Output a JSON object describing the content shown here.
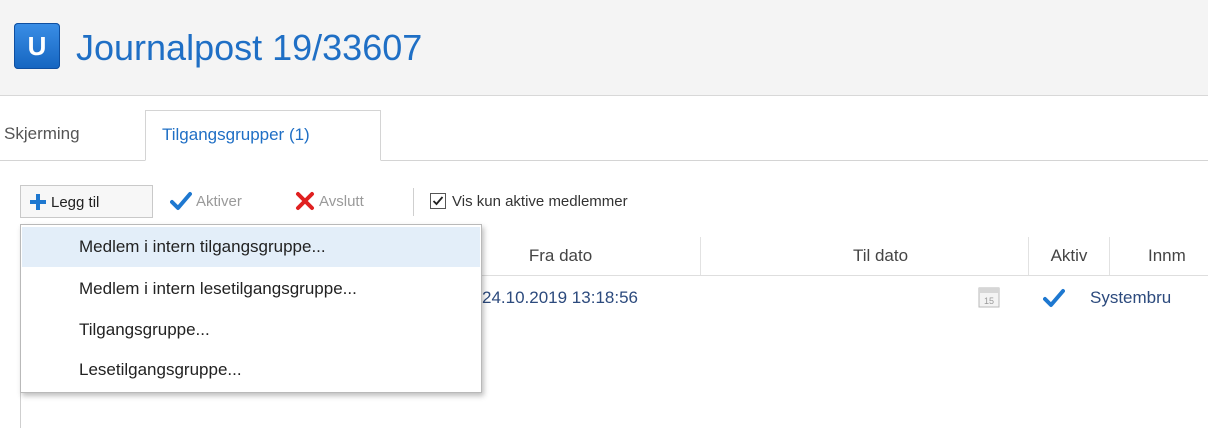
{
  "header": {
    "app_icon_letter": "U",
    "title": "Journalpost 19/33607",
    "brand_color": "#1f6fc5"
  },
  "tabs": [
    {
      "label": "Skjerming",
      "active": false
    },
    {
      "label": "Tilgangsgrupper (1)",
      "active": true
    }
  ],
  "toolbar": {
    "add_label": "Legg til",
    "activate_label": "Aktiver",
    "end_label": "Avslutt",
    "show_active_label": "Vis kun aktive medlemmer",
    "show_active_checked": true
  },
  "dropdown": {
    "items": [
      "Medlem i intern tilgangsgruppe...",
      "Medlem i intern lesetilgangsgruppe...",
      "Tilgangsgruppe...",
      "Lesetilgangsgruppe..."
    ],
    "highlighted_index": 0
  },
  "grid": {
    "columns": [
      "Fra dato",
      "Til dato",
      "Aktiv",
      "Innm"
    ],
    "rows": [
      {
        "fra_dato": "24.10.2019 13:18:56",
        "til_dato": "",
        "calendar_icon_text": "15",
        "aktiv": true,
        "user": "Systembru"
      }
    ]
  },
  "icons": {
    "add": "plus-icon",
    "activate": "checkmark-icon",
    "end": "cross-icon",
    "calendar": "calendar-icon",
    "active_flag": "checkmark-icon"
  },
  "colors": {
    "accent": "#1f6fc5",
    "check": "#1e78d0",
    "cross": "#e02020",
    "menu_highlight": "#e3eef9"
  }
}
